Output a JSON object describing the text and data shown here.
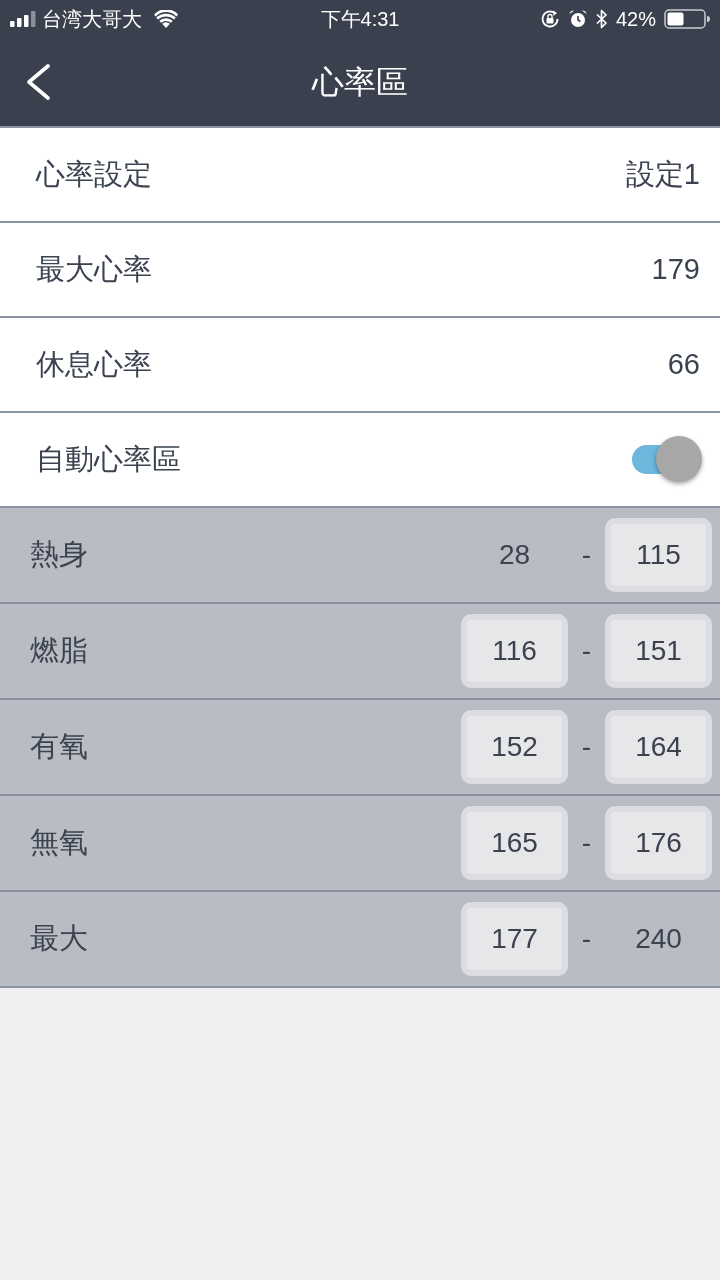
{
  "status_bar": {
    "carrier": "台湾大哥大",
    "time": "下午4:31",
    "battery": "42%"
  },
  "nav_bar": {
    "title": "心率區"
  },
  "settings": [
    {
      "kind": "value",
      "label": "心率設定",
      "value": "設定1"
    },
    {
      "kind": "value",
      "label": "最大心率",
      "value": "179"
    },
    {
      "kind": "value",
      "label": "休息心率",
      "value": "66"
    },
    {
      "kind": "toggle",
      "label": "自動心率區",
      "on": true
    }
  ],
  "zones": [
    {
      "label": "熱身",
      "low": {
        "value": "28",
        "editable": false
      },
      "separator": "-",
      "high": {
        "value": "115",
        "editable": true
      }
    },
    {
      "label": "燃脂",
      "low": {
        "value": "116",
        "editable": true
      },
      "separator": "-",
      "high": {
        "value": "151",
        "editable": true
      }
    },
    {
      "label": "有氧",
      "low": {
        "value": "152",
        "editable": true
      },
      "separator": "-",
      "high": {
        "value": "164",
        "editable": true
      }
    },
    {
      "label": "無氧",
      "low": {
        "value": "165",
        "editable": true
      },
      "separator": "-",
      "high": {
        "value": "176",
        "editable": true
      }
    },
    {
      "label": "最大",
      "low": {
        "value": "177",
        "editable": true
      },
      "separator": "-",
      "high": {
        "value": "240",
        "editable": false
      }
    }
  ]
}
